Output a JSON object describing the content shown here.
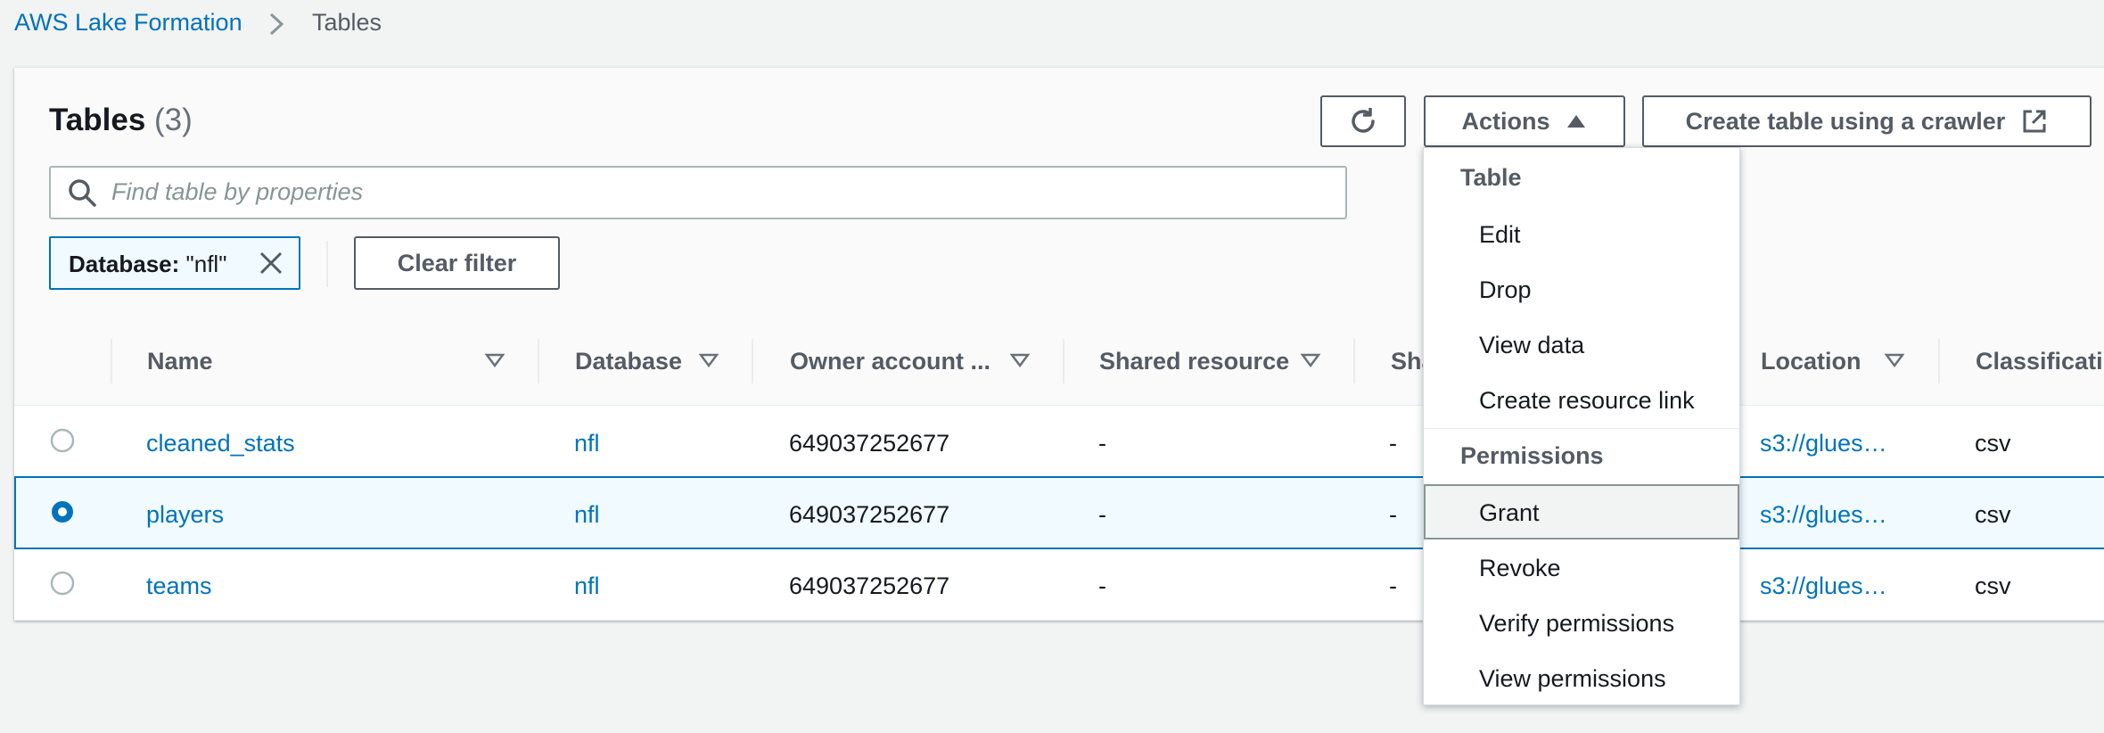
{
  "breadcrumb": {
    "root": "AWS Lake Formation",
    "current": "Tables"
  },
  "panel": {
    "title": "Tables",
    "count": "(3)"
  },
  "toolbar": {
    "refresh_icon": "refresh-icon",
    "actions_label": "Actions",
    "crawler_label": "Create table using a crawler"
  },
  "search": {
    "placeholder": "Find table by properties"
  },
  "filter": {
    "token_key": "Database:",
    "token_value": "\"nfl\"",
    "clear_label": "Clear filter"
  },
  "table": {
    "columns": [
      "Name",
      "Database",
      "Owner account ...",
      "Shared resource",
      "Sha",
      "Location",
      "Classificati"
    ],
    "rows": [
      {
        "name": "cleaned_stats",
        "database": "nfl",
        "owner": "649037252677",
        "shared": "-",
        "sha": "-",
        "location": "s3://glues…",
        "classification": "csv",
        "selected": false
      },
      {
        "name": "players",
        "database": "nfl",
        "owner": "649037252677",
        "shared": "-",
        "sha": "-",
        "location": "s3://glues…",
        "classification": "csv",
        "selected": true
      },
      {
        "name": "teams",
        "database": "nfl",
        "owner": "649037252677",
        "shared": "-",
        "sha": "-",
        "location": "s3://glues…",
        "classification": "csv",
        "selected": false
      }
    ]
  },
  "menu": {
    "group_table": "Table",
    "edit": "Edit",
    "drop": "Drop",
    "view_data": "View data",
    "create_resource_link": "Create resource link",
    "group_permissions": "Permissions",
    "grant": "Grant",
    "revoke": "Revoke",
    "verify_permissions": "Verify permissions",
    "view_permissions": "View permissions"
  },
  "colors": {
    "link": "#0073bb",
    "selected_bg": "#f1faff",
    "border": "#545b64"
  }
}
